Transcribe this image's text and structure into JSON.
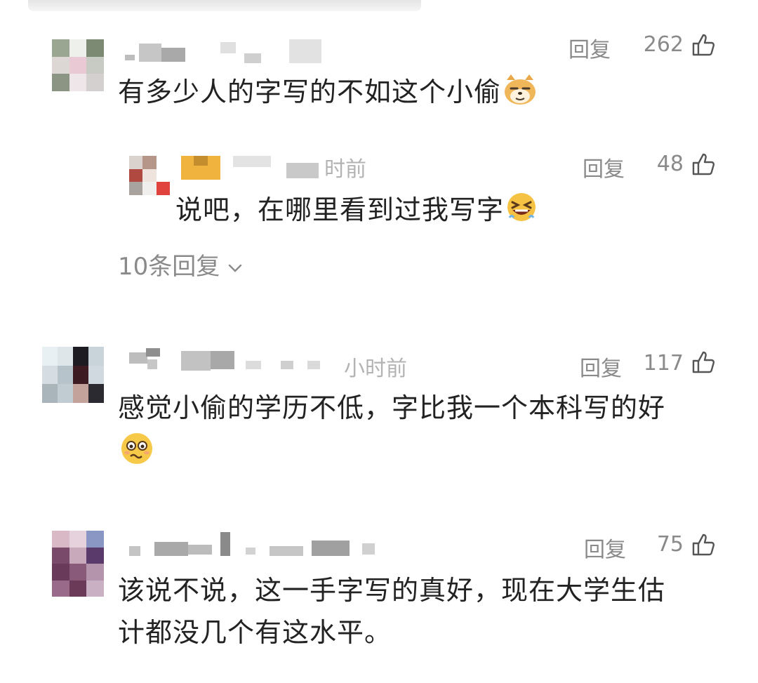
{
  "comments": [
    {
      "text": "有多少人的字写的不如这个小偷",
      "emoji": "smirk-dog-emoji",
      "reply_label": "回复",
      "likes": "262",
      "time": "",
      "replies": [
        {
          "time_fragment": "时前",
          "text": "说吧，在哪里看到过我写字",
          "emoji": "grinning-squint-emoji",
          "reply_label": "回复",
          "likes": "48"
        }
      ],
      "more_replies_label": "10条回复"
    },
    {
      "time_fragment": "小时前",
      "text": "感觉小偷的学历不低，字比我一个本科写的好",
      "emoji": "woozy-face-emoji",
      "reply_label": "回复",
      "likes": "117"
    },
    {
      "time_fragment": "",
      "text_line1": "该说不说，这一手字写的真好，现在大学生估",
      "text_line2": "计都没几个有这水平。",
      "reply_label": "回复",
      "likes": "75"
    }
  ],
  "icons": {
    "like": "thumbs-up-icon",
    "expand": "chevron-down-icon"
  },
  "colors": {
    "text": "#222222",
    "secondary": "#8a8a8a",
    "muted": "#b3b3b3"
  }
}
